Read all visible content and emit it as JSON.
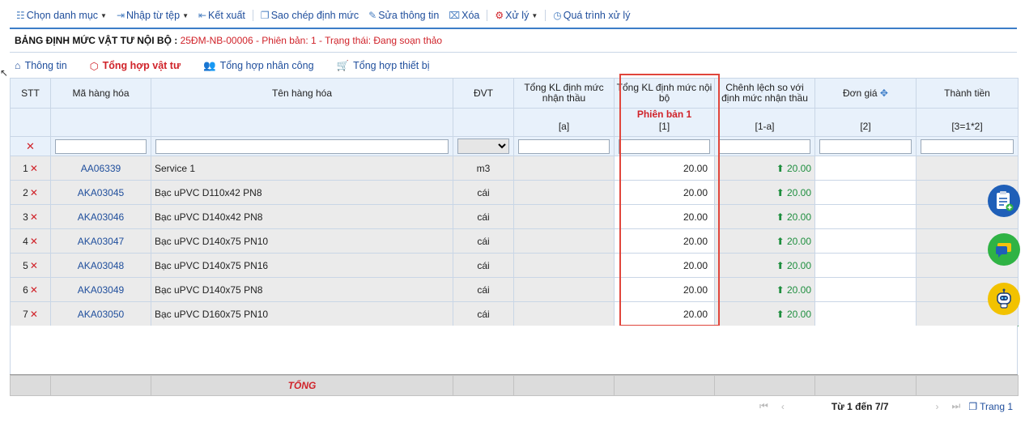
{
  "toolbar": {
    "choose_category": "Chọn danh mục",
    "import_file": "Nhập từ tệp",
    "export": "Kết xuất",
    "copy_norm": "Sao chép định mức",
    "edit_info": "Sửa thông tin",
    "delete": "Xóa",
    "process": "Xử lý",
    "process_history": "Quá trình xử lý"
  },
  "document": {
    "label": "BẢNG ĐỊNH MỨC VẬT TƯ NỘI BỘ :",
    "value": "25ĐM-NB-00006 - Phiên bản: 1 - Trạng thái: Đang soạn thảo"
  },
  "tabs": [
    {
      "label": "Thông tin",
      "icon": "home-icon"
    },
    {
      "label": "Tổng hợp vật tư",
      "icon": "cube-icon",
      "active": true
    },
    {
      "label": "Tổng hợp nhân công",
      "icon": "users-icon"
    },
    {
      "label": "Tổng hợp thiết bị",
      "icon": "cart-icon"
    }
  ],
  "columns": {
    "stt": "STT",
    "code": "Mã hàng hóa",
    "name": "Tên hàng hóa",
    "unit": "ĐVT",
    "bid_total": "Tổng KL định mức nhận thầu",
    "internal_total": "Tổng KL định mức nội bộ",
    "diff": "Chênh lệch so với định mức nhận thầu",
    "unit_price": "Đơn giá",
    "amount": "Thành tiền"
  },
  "subheaders": {
    "bid_total": "[a]",
    "version": "Phiên bản 1",
    "internal_total": "[1]",
    "diff": "[1-a]",
    "unit_price": "[2]",
    "amount": "[3=1*2]"
  },
  "rows": [
    {
      "stt": "1",
      "code": "AA06339",
      "name": "Service 1",
      "unit": "m3",
      "internal": "20.00",
      "diff": "20.00"
    },
    {
      "stt": "2",
      "code": "AKA03045",
      "name": "Bạc uPVC D110x42 PN8",
      "unit": "cái",
      "internal": "20.00",
      "diff": "20.00"
    },
    {
      "stt": "3",
      "code": "AKA03046",
      "name": "Bạc uPVC D140x42 PN8",
      "unit": "cái",
      "internal": "20.00",
      "diff": "20.00"
    },
    {
      "stt": "4",
      "code": "AKA03047",
      "name": "Bạc uPVC D140x75 PN10",
      "unit": "cái",
      "internal": "20.00",
      "diff": "20.00"
    },
    {
      "stt": "5",
      "code": "AKA03048",
      "name": "Bạc uPVC D140x75 PN16",
      "unit": "cái",
      "internal": "20.00",
      "diff": "20.00"
    },
    {
      "stt": "6",
      "code": "AKA03049",
      "name": "Bạc uPVC D140x75 PN8",
      "unit": "cái",
      "internal": "20.00",
      "diff": "20.00"
    },
    {
      "stt": "7",
      "code": "AKA03050",
      "name": "Bạc uPVC D160x75 PN10",
      "unit": "cái",
      "internal": "20.00",
      "diff": "20.00"
    }
  ],
  "footer": {
    "total_label": "TỔNG"
  },
  "pager": {
    "range": "Từ 1 đến 7/7",
    "page": "Trang 1"
  },
  "colors": {
    "accent": "#1f4e9c",
    "danger": "#d0232a",
    "positive": "#1e8e3e",
    "highlight": "#e0463c"
  }
}
